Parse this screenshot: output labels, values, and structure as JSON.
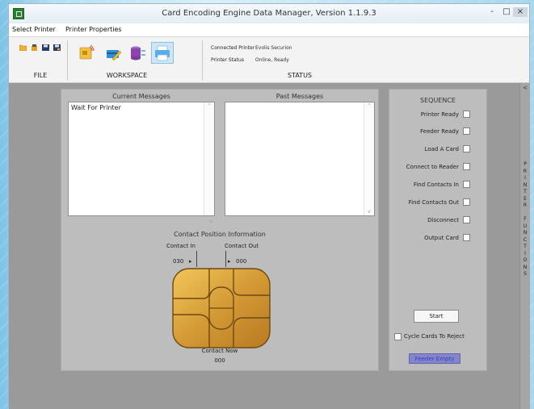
{
  "window": {
    "title": "Card Encoding Engine Data Manager, Version 1.1.9.3"
  },
  "menu": {
    "items": [
      "Select Printer",
      "Printer Properties"
    ]
  },
  "ribbon": {
    "file_label": "FILE",
    "workspace_label": "WORKSPACE",
    "status_label": "STATUS",
    "status": {
      "connected_printer_label": "Connected Printer",
      "connected_printer_value": "Evolis Securion",
      "printer_status_label": "Printer Status",
      "printer_status_value": "Online, Ready"
    },
    "file_icons": [
      "open-folder-icon",
      "load-icon",
      "save-icon",
      "save-as-icon"
    ],
    "workspace_icons": [
      "card-wireless-icon",
      "card-edit-icon",
      "database-export-icon",
      "printer-icon"
    ],
    "colors": {
      "folder": "#f0b030",
      "workspace_accent": "#2f8fd8",
      "printer_selected": "#5aaee6"
    }
  },
  "messages": {
    "current_title": "Current Messages",
    "past_title": "Past Messages",
    "current_items": [
      "Wait For Printer"
    ],
    "past_items": []
  },
  "contact": {
    "title": "Contact Position Information",
    "contact_in_label": "Contact In",
    "contact_out_label": "Contact Out",
    "contact_in_value": "030",
    "contact_out_value": "000",
    "contact_now_label": "Contact Now",
    "contact_now_value": "000"
  },
  "sequence": {
    "title": "SEQUENCE",
    "steps": [
      "Printer Ready",
      "Feeder Ready",
      "Load A Card",
      "Connect to Reader",
      "Find Contacts In",
      "Find Contacts Out",
      "Disconnect",
      "Output Card"
    ],
    "start_label": "Start",
    "cycle_label": "Cycle Cards To Reject",
    "feeder_status": "Feeder Empty"
  },
  "side_tab": {
    "label": "PRINTER FUNCTIONS",
    "letters": [
      "P",
      "R",
      "I",
      "N",
      "T",
      "E",
      "R",
      " ",
      "F",
      "U",
      "N",
      "C",
      "T",
      "I",
      "O",
      "N",
      "S"
    ],
    "collapse_arrow": "<"
  },
  "window_controls": {
    "minimize": "-",
    "maximize": "□",
    "close": "×"
  }
}
